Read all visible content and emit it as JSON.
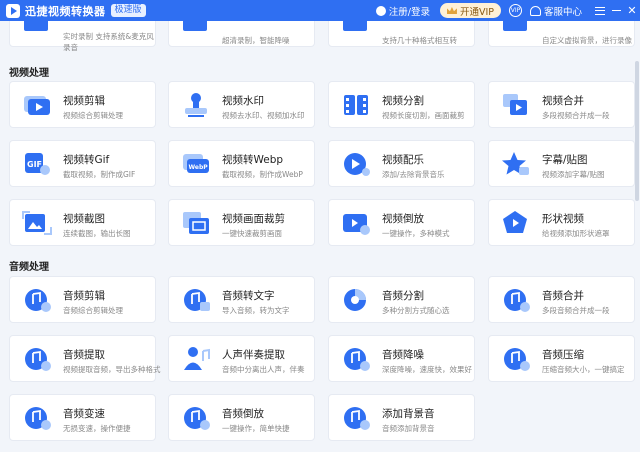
{
  "app": {
    "title": "迅捷视频转换器",
    "badge": "极速版",
    "login": "注册/登录",
    "vip": "开通VIP",
    "vip_circle": "VIP",
    "service": "客服中心",
    "close": "✕"
  },
  "top_row": [
    {
      "desc1": "实时录制 支持系统&麦克风",
      "desc2": "录音"
    },
    {
      "desc1": "超清录制，智能降噪",
      "desc2": ""
    },
    {
      "desc1": "支持几十种格式相互转",
      "desc2": ""
    },
    {
      "desc1": "自定义虚拟背景，进行录像",
      "desc2": ""
    }
  ],
  "sections": {
    "video": "视频处理",
    "audio": "音频处理"
  },
  "video_tools": [
    {
      "name": "视频剪辑",
      "desc": "视频综合剪辑处理",
      "icon": "scissors-film-icon"
    },
    {
      "name": "视频水印",
      "desc": "视频去水印、视频加水印",
      "icon": "stamp-icon"
    },
    {
      "name": "视频分割",
      "desc": "视频长度切割，画面裁剪",
      "icon": "film-split-icon"
    },
    {
      "name": "视频合并",
      "desc": "多段视频合并成一段",
      "icon": "merge-icon"
    },
    {
      "name": "视频转Gif",
      "desc": "截取视频，制作成GIF",
      "icon": "gif-icon"
    },
    {
      "name": "视频转Webp",
      "desc": "截取视频，制作成WebP",
      "icon": "webp-icon"
    },
    {
      "name": "视频配乐",
      "desc": "添加/去除背景音乐",
      "icon": "music-play-icon"
    },
    {
      "name": "字幕/贴图",
      "desc": "视频添加字幕/贴图",
      "icon": "star-sticker-icon"
    },
    {
      "name": "视频截图",
      "desc": "连续截图，输出长图",
      "icon": "screenshot-icon"
    },
    {
      "name": "视频画面裁剪",
      "desc": "一键快速裁剪画面",
      "icon": "crop-icon"
    },
    {
      "name": "视频倒放",
      "desc": "一键操作，多种模式",
      "icon": "reverse-icon"
    },
    {
      "name": "形状视频",
      "desc": "给视频添加形状遮罩",
      "icon": "shape-icon"
    }
  ],
  "audio_tools": [
    {
      "name": "音频剪辑",
      "desc": "音频综合剪辑处理",
      "icon": "audio-cut-icon"
    },
    {
      "name": "音频转文字",
      "desc": "导入音频，转为文字",
      "icon": "audio-text-icon"
    },
    {
      "name": "音频分割",
      "desc": "多种分割方式随心选",
      "icon": "audio-split-icon"
    },
    {
      "name": "音频合并",
      "desc": "多段音频合并成一段",
      "icon": "audio-merge-icon"
    },
    {
      "name": "音频提取",
      "desc": "视频提取音频，导出多种格式",
      "icon": "audio-extract-icon"
    },
    {
      "name": "人声伴奏提取",
      "desc": "音频中分离出人声，伴奏",
      "icon": "vocal-icon"
    },
    {
      "name": "音频降噪",
      "desc": "深度降噪，速度快，效果好",
      "icon": "denoise-icon"
    },
    {
      "name": "音频压缩",
      "desc": "压缩音频大小，一键搞定",
      "icon": "compress-icon"
    },
    {
      "name": "音频变速",
      "desc": "无损变速，操作便捷",
      "icon": "speed-icon"
    },
    {
      "name": "音频倒放",
      "desc": "一键操作，简单快捷",
      "icon": "audio-reverse-icon"
    },
    {
      "name": "添加背景音",
      "desc": "音频添加背景音",
      "icon": "bg-music-icon"
    }
  ],
  "colors": {
    "accent": "#2f6ff2",
    "icon_light": "#a9c8fb",
    "icon_dark": "#2f6ff2"
  }
}
